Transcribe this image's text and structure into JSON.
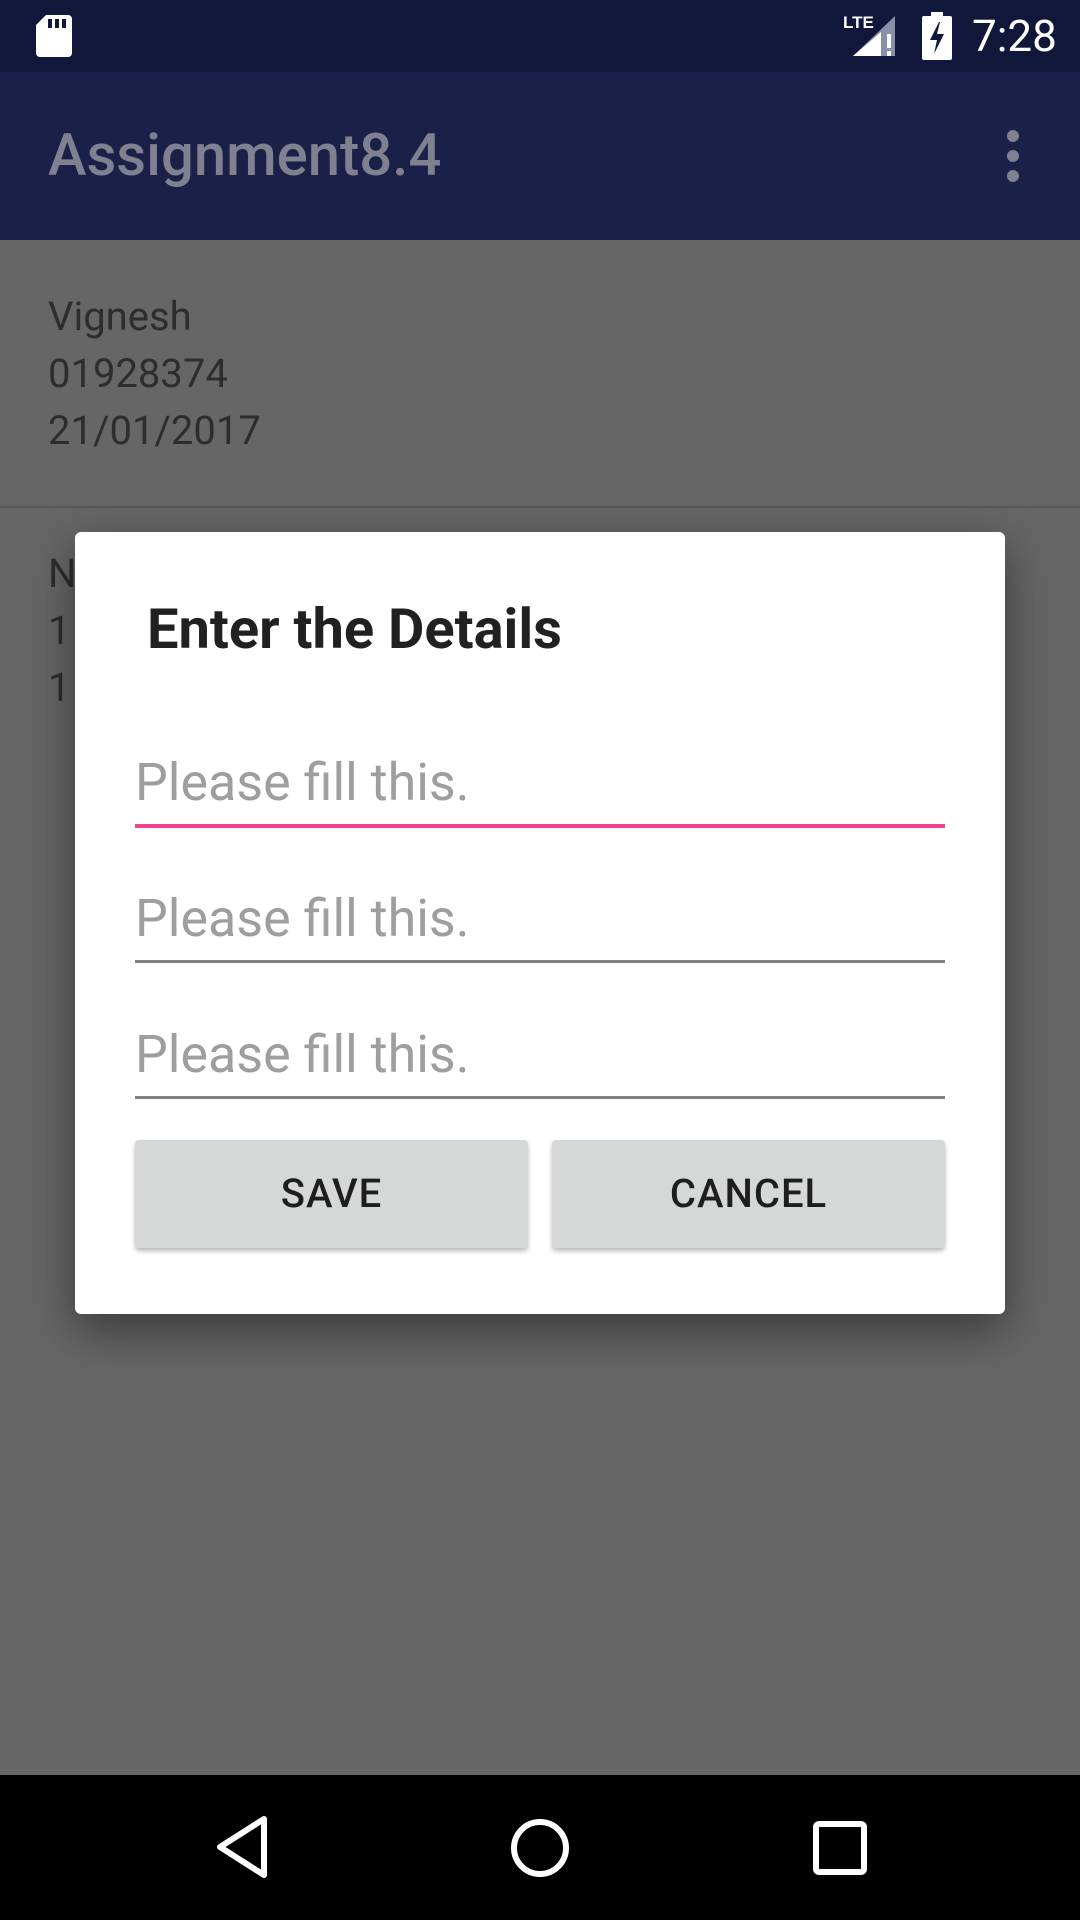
{
  "status_bar": {
    "time": "7:28",
    "network_label": "LTE",
    "icons": [
      "sd-card-icon",
      "lte-signal-icon",
      "battery-charging-icon"
    ]
  },
  "app_bar": {
    "title": "Assignment8.4",
    "menu_icon": "more-vert-icon"
  },
  "list": {
    "items": [
      {
        "name": "Vignesh",
        "number": "01928374",
        "date": "21/01/2017"
      },
      {
        "name": "N",
        "number": "1",
        "date": "1"
      }
    ]
  },
  "dialog": {
    "title": "Enter the Details",
    "fields": [
      {
        "placeholder": "Please fill this.",
        "value": ""
      },
      {
        "placeholder": "Please fill this.",
        "value": ""
      },
      {
        "placeholder": "Please fill this.",
        "value": ""
      }
    ],
    "save_label": "SAVE",
    "cancel_label": "CANCEL"
  },
  "colors": {
    "status_bar": "#10173A",
    "app_bar_dimmed": "#1A2048",
    "scrim_background": "#666666",
    "accent": "#F0418A",
    "button": "#D6D7D7"
  },
  "nav_bar": {
    "icons": [
      "back-icon",
      "home-icon",
      "recents-icon"
    ]
  }
}
